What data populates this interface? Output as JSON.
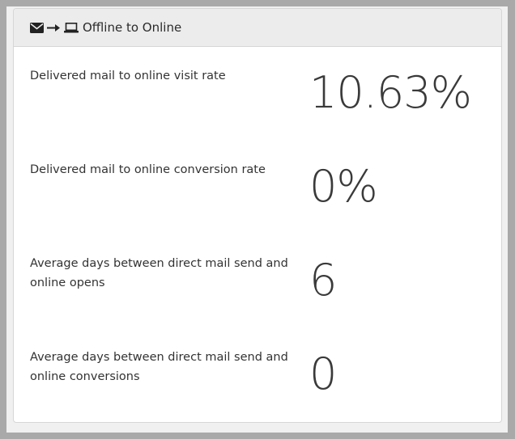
{
  "panel": {
    "title": "Offline to Online",
    "icons": [
      "envelope-icon",
      "arrow-right-icon",
      "laptop-icon"
    ]
  },
  "metrics": [
    {
      "label": "Delivered mail to online visit rate",
      "value": "10.63%"
    },
    {
      "label": "Delivered mail to online conversion rate",
      "value": "0%"
    },
    {
      "label": "Average days between direct mail send and online opens",
      "value": "6"
    },
    {
      "label": "Average days between direct mail send and online conversions",
      "value": "0"
    }
  ]
}
